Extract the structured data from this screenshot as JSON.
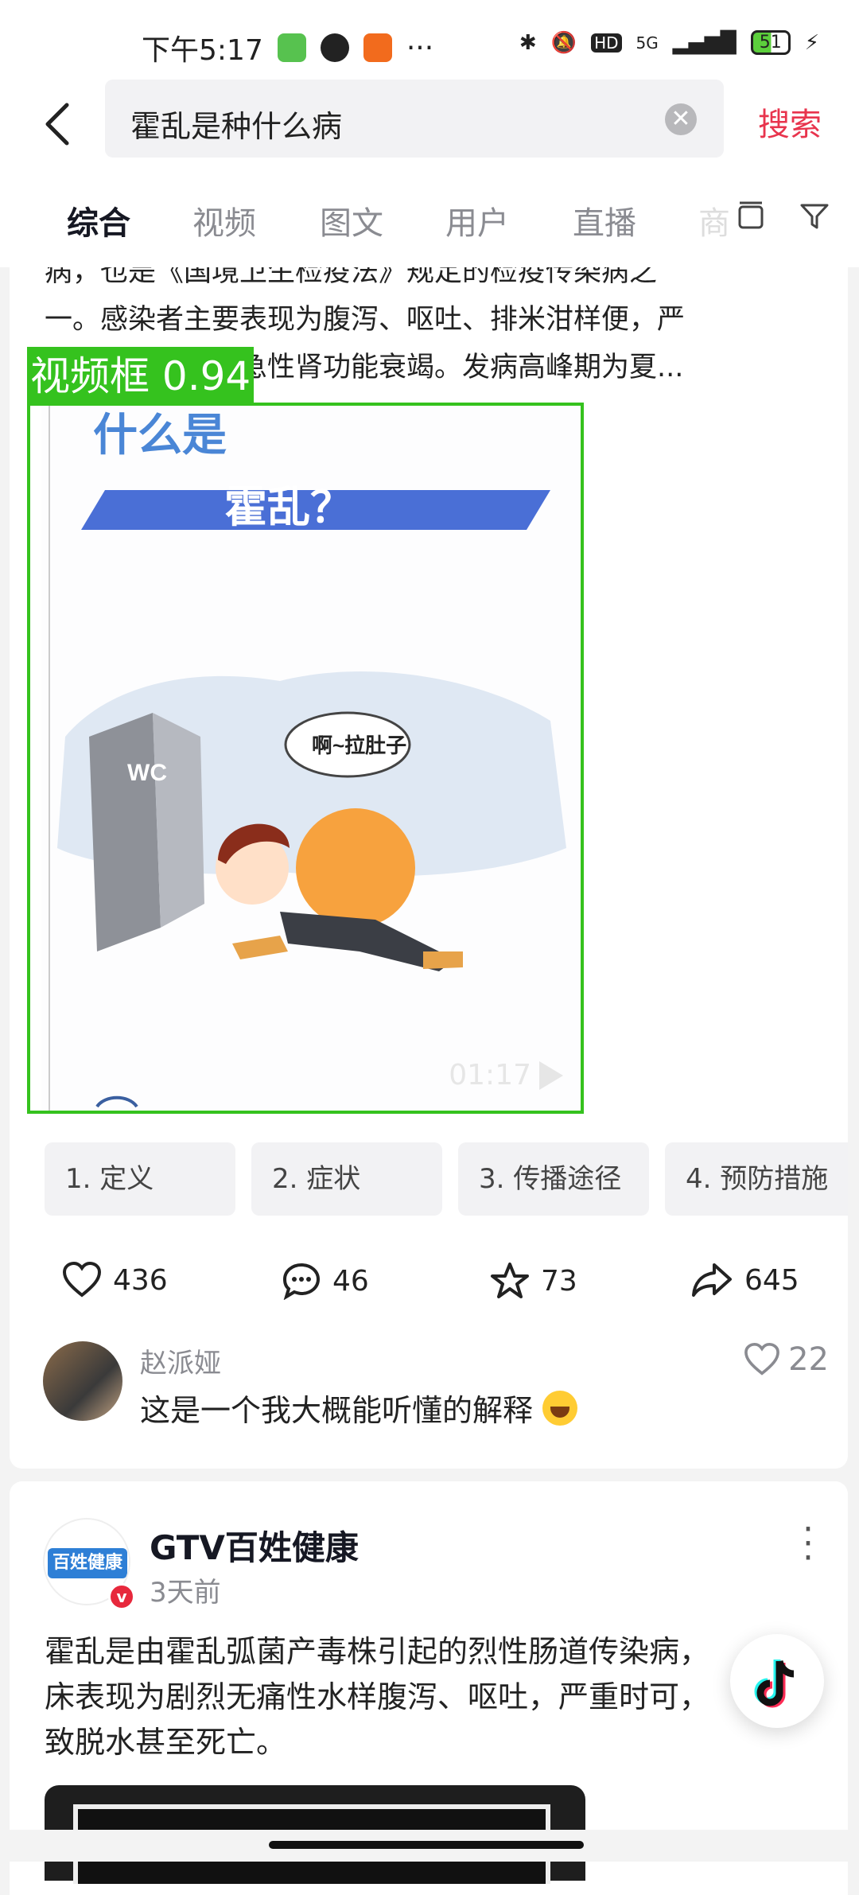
{
  "status_bar": {
    "time": "下午5:17",
    "network": "5G",
    "battery": "51"
  },
  "search": {
    "back_icon": "chevron-left-icon",
    "query": "霍乱是种什么病",
    "clear_icon": "clear-circle-icon",
    "button_label": "搜索"
  },
  "tabs": {
    "items": [
      "综合",
      "视频",
      "图文",
      "用户",
      "直播"
    ],
    "active": "综合",
    "overflow_label": "商",
    "icons": [
      "layout-icon",
      "filter-icon"
    ]
  },
  "result1": {
    "excerpt_lines": [
      "病，也是《国境卫生检疫法》规定的检疫传染病之",
      "一。感染者主要表现为腹泻、呕吐、排米泔样便，严",
      "重者可出现休克急性肾功能衰竭。发病高峰期为夏..."
    ],
    "detection_label": "视频框 0.94",
    "video": {
      "title_line1": "什么是",
      "title_line2": "霍乱？",
      "bubble_text": "啊~拉肚子",
      "door_text": "WC",
      "duration": "01:17"
    },
    "chapters": [
      "1. 定义",
      "2. 症状",
      "3. 传播途径",
      "4. 预防措施"
    ],
    "stats": {
      "likes": "436",
      "comments": "46",
      "favorites": "73",
      "shares": "645"
    },
    "top_comment": {
      "user": "赵派娅",
      "text": "这是一个我大概能听懂的解释",
      "likes": "22"
    }
  },
  "result2": {
    "account": "GTV百姓健康",
    "logo_text": "百姓健康",
    "time": "3天前",
    "text_lines": [
      "霍乱是由霍乱弧菌产毒株引起的烈性肠道传染病，",
      "床表现为剧烈无痛性水样腹泻、呕吐，严重时可，",
      "致脱水甚至死亡。"
    ]
  },
  "colors": {
    "accent": "#e8344d",
    "detection": "#35c21e",
    "banner": "#4a6fd6"
  }
}
